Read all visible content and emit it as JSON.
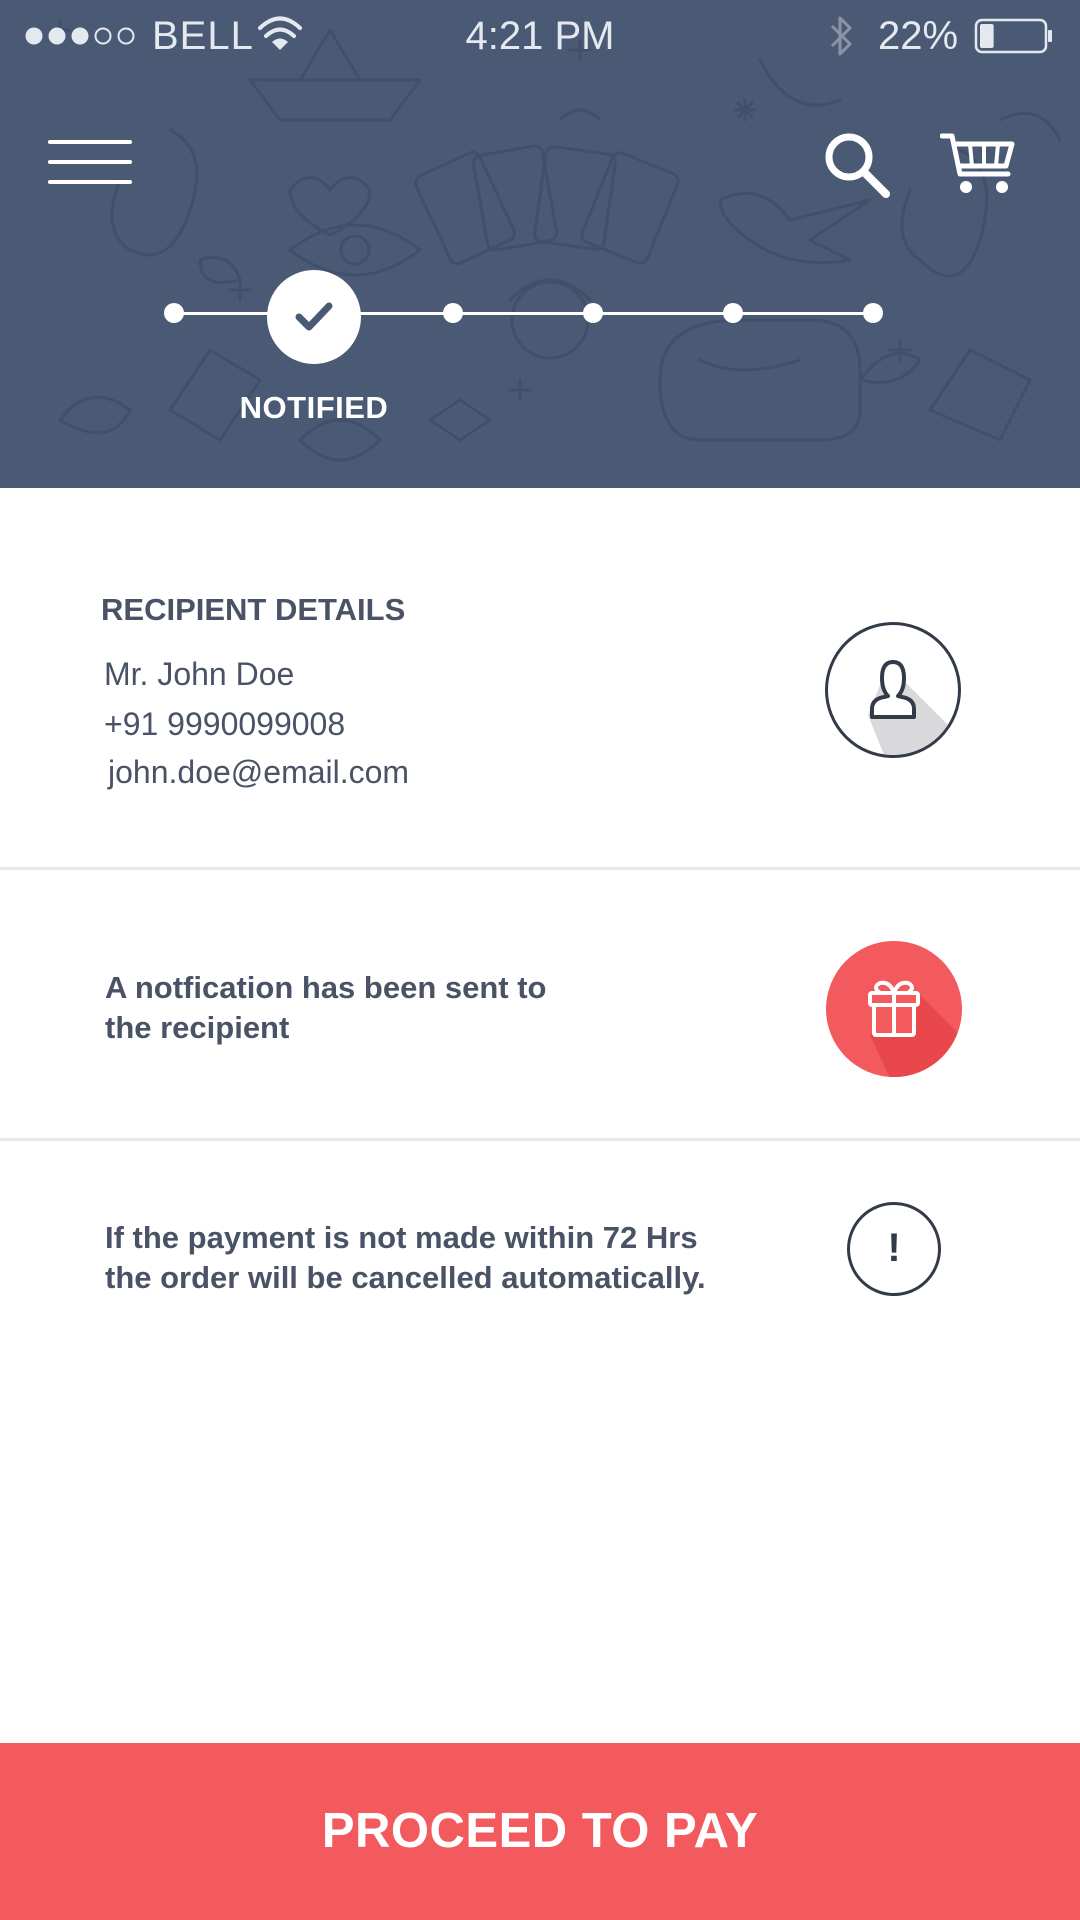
{
  "status_bar": {
    "carrier": "BELL",
    "time": "4:21 PM",
    "battery_percent": "22%",
    "signal_bars": 3,
    "signal_total": 5,
    "battery_level": 0.22
  },
  "header": {
    "menu_icon": "hamburger-menu-icon",
    "search_icon": "search-icon",
    "cart_icon": "cart-icon",
    "background_color": "#4b5a74"
  },
  "stepper": {
    "active_step_label": "NOTIFIED",
    "active_step_index": 1,
    "total_steps": 6
  },
  "recipient": {
    "title": "RECIPIENT DETAILS",
    "name": "Mr. John Doe",
    "phone": "+91 9990099008",
    "email": "john.doe@email.com",
    "icon": "user-icon"
  },
  "notification": {
    "message_line1": "A notfication has been sent to",
    "message_line2": "the recipient",
    "icon": "gift-icon",
    "accent_color": "#f25a5e"
  },
  "payment_notice": {
    "message_line1": "If the payment is not made within 72 Hrs",
    "message_line2": "the order will be cancelled automatically.",
    "icon": "alert-icon",
    "icon_glyph": "!"
  },
  "footer": {
    "pay_button_label": "PROCEED TO PAY",
    "button_color": "#f25a5e"
  }
}
